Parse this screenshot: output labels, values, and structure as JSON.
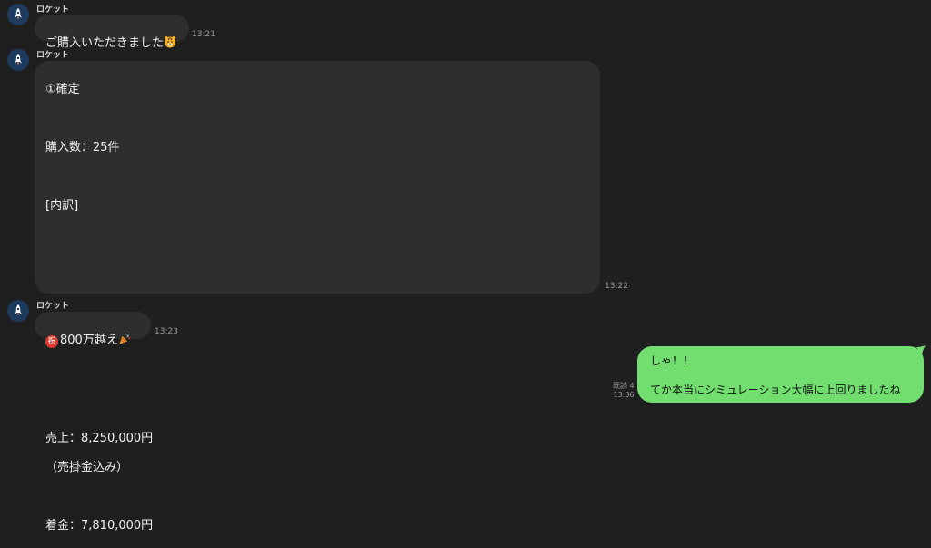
{
  "messages": [
    {
      "sender": "ロケット",
      "text": "ご購入いただきました",
      "emoji": "tiger-face",
      "time": "13:21"
    },
    {
      "sender": "ロケット",
      "lines": [
        "①確定",
        "",
        "購入数：25件",
        "",
        "[内訳]",
        "",
        "",
        "",
        "",
        "",
        "",
        "",
        "売上：8,250,000円",
        "（売掛金込み）",
        "",
        "着金：7,810,000円"
      ],
      "time": "13:22"
    },
    {
      "sender": "ロケット",
      "badge": "祝",
      "text": "800万越え",
      "emoji": "party-popper",
      "time": "13:23"
    },
    {
      "self": true,
      "lines": [
        "しゃ！！",
        "",
        "てか本当にシミュレーション大幅に上回りましたね"
      ],
      "read_label": "既読 4",
      "time": "13:36"
    }
  ],
  "colors": {
    "background": "#1f1f1f",
    "incoming_bubble": "#2e2e2e",
    "outgoing_bubble": "#71de6f",
    "avatar": "#1d3a5f",
    "badge": "#e0392b"
  }
}
